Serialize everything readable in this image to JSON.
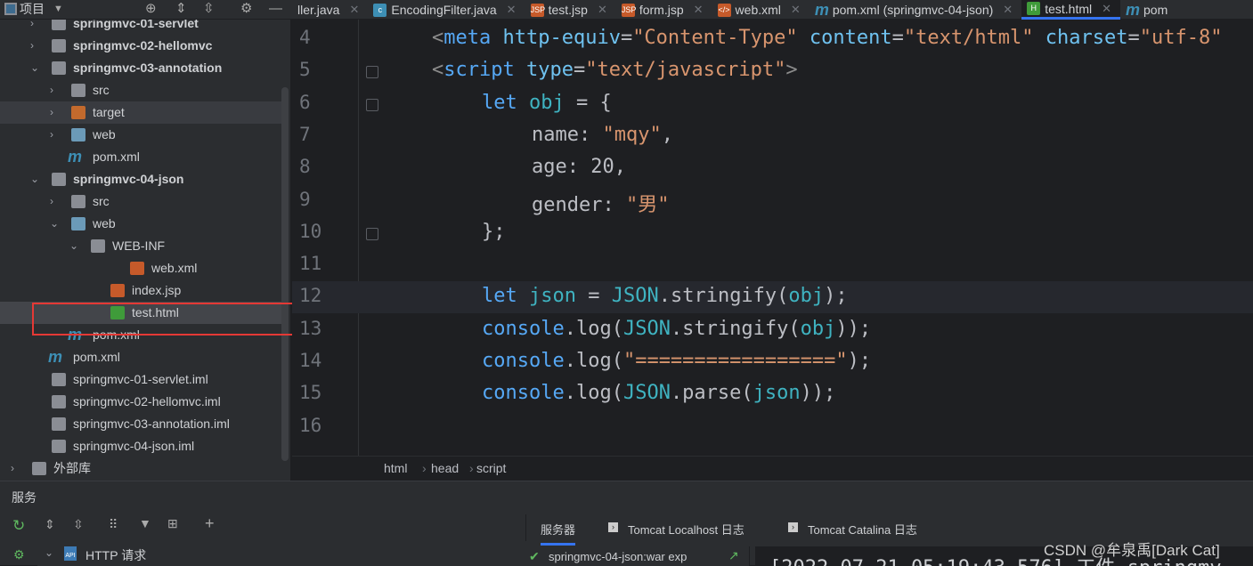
{
  "topbar": {
    "project_label": "项目"
  },
  "tabs": [
    {
      "label": "ller.java",
      "icon": "java-icon"
    },
    {
      "label": "EncodingFilter.java",
      "icon": "class-icon"
    },
    {
      "label": "test.jsp",
      "icon": "jsp-icon"
    },
    {
      "label": "form.jsp",
      "icon": "jsp-icon"
    },
    {
      "label": "web.xml",
      "icon": "xml-icon"
    },
    {
      "label": "pom.xml (springmvc-04-json)",
      "icon": "maven-icon"
    },
    {
      "label": "test.html",
      "icon": "html-icon",
      "active": true
    },
    {
      "label": "pom",
      "icon": "maven-icon"
    }
  ],
  "tree": [
    {
      "label": "springmvc-01-servlet",
      "depth": 1,
      "chev": "›",
      "type": "module",
      "bold": true
    },
    {
      "label": "springmvc-02-hellomvc",
      "depth": 1,
      "chev": "›",
      "type": "module",
      "bold": true
    },
    {
      "label": "springmvc-03-annotation",
      "depth": 1,
      "chev": "⌄",
      "type": "module",
      "bold": true
    },
    {
      "label": "src",
      "depth": 2,
      "chev": "›",
      "type": "folder"
    },
    {
      "label": "target",
      "depth": 2,
      "chev": "›",
      "type": "target",
      "hl": true
    },
    {
      "label": "web",
      "depth": 2,
      "chev": "›",
      "type": "web"
    },
    {
      "label": "pom.xml",
      "depth": 2,
      "type": "maven"
    },
    {
      "label": "springmvc-04-json",
      "depth": 1,
      "chev": "⌄",
      "type": "module",
      "bold": true
    },
    {
      "label": "src",
      "depth": 2,
      "chev": "›",
      "type": "folder"
    },
    {
      "label": "web",
      "depth": 2,
      "chev": "⌄",
      "type": "web"
    },
    {
      "label": "WEB-INF",
      "depth": 3,
      "chev": "⌄",
      "type": "folder"
    },
    {
      "label": "web.xml",
      "depth": 5,
      "type": "xml"
    },
    {
      "label": "index.jsp",
      "depth": 4,
      "type": "jsp"
    },
    {
      "label": "test.html",
      "depth": 4,
      "type": "html",
      "sel": true
    },
    {
      "label": "pom.xml",
      "depth": 2,
      "type": "maven"
    },
    {
      "label": "pom.xml",
      "depth": 1,
      "type": "maven"
    },
    {
      "label": "springmvc-01-servlet.iml",
      "depth": 1,
      "type": "file"
    },
    {
      "label": "springmvc-02-hellomvc.iml",
      "depth": 1,
      "type": "file"
    },
    {
      "label": "springmvc-03-annotation.iml",
      "depth": 1,
      "type": "file"
    },
    {
      "label": "springmvc-04-json.iml",
      "depth": 1,
      "type": "file"
    },
    {
      "label": "外部库",
      "depth": 0,
      "chev": "›",
      "type": "lib"
    }
  ],
  "code": [
    {
      "n": "4",
      "html": "<span class='g'>&lt;</span><span class='t'>meta</span> <span class='a'>http-equiv</span>=<span class='s'>\"Content-Type\"</span> <span class='a'>content</span>=<span class='s'>\"text/html\"</span> <span class='a'>charset</span>=<span class='s'>\"utf-8\"</span>",
      "ind": 0
    },
    {
      "n": "5",
      "html": "<span class='g'>&lt;</span><span class='t'>script</span> <span class='a'>type</span>=<span class='s'>\"text/javascript\"</span><span class='g'>&gt;</span>",
      "ind": 0
    },
    {
      "n": "6",
      "html": "<span class='k'>let</span> <span class='v'>obj</span> = {",
      "ind": 1
    },
    {
      "n": "7",
      "html": "name: <span class='s'>\"mqy\"</span>,",
      "ind": 2
    },
    {
      "n": "8",
      "html": "age: 20,",
      "ind": 2
    },
    {
      "n": "9",
      "html": "gender: <span class='s'>\"男\"</span>",
      "ind": 2
    },
    {
      "n": "10",
      "html": "};",
      "ind": 1
    },
    {
      "n": "11",
      "html": "",
      "ind": 0
    },
    {
      "n": "12",
      "html": "<span class='k'>let</span> <span class='v'>json</span> = <span class='v'>JSON</span>.stringify(<span class='v'>obj</span>);",
      "ind": 1,
      "current": true
    },
    {
      "n": "13",
      "html": "<span class='k'>console</span>.log(<span class='v'>JSON</span>.stringify(<span class='v'>obj</span>));",
      "ind": 1
    },
    {
      "n": "14",
      "html": "<span class='k'>console</span>.log(<span class='s'>\"=================\"</span>);",
      "ind": 1
    },
    {
      "n": "15",
      "html": "<span class='k'>console</span>.log(<span class='v'>JSON</span>.parse(<span class='v'>json</span>));",
      "ind": 1
    },
    {
      "n": "16",
      "html": "",
      "ind": 0
    }
  ],
  "breadcrumb": [
    "html",
    "head",
    "script"
  ],
  "services": {
    "title": "服务",
    "tree_item": "HTTP 请求",
    "tabs": [
      "服务器",
      "Tomcat Localhost 日志",
      "Tomcat Catalina 日志"
    ],
    "deploy_item": "springmvc-04-json:war exp",
    "console_line": "[2022-07-21 05:19:43,576] 工件 springmv",
    "watermark": "CSDN @牟泉禹[Dark Cat]"
  }
}
